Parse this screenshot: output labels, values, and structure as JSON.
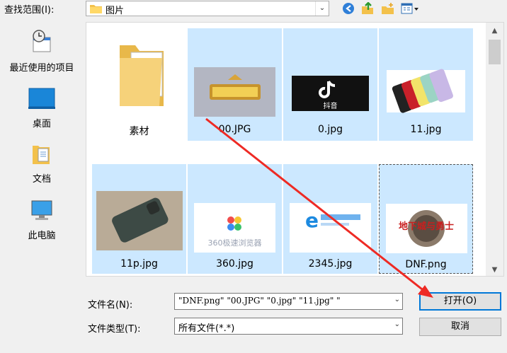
{
  "look_in": {
    "label": "查找范围(I):",
    "value": "图片"
  },
  "toolbar": {
    "icons": [
      "back-icon",
      "up-folder-icon",
      "new-folder-icon",
      "view-menu-icon"
    ]
  },
  "places": [
    {
      "label": "最近使用的项目",
      "icon": "recent-items-icon"
    },
    {
      "label": "桌面",
      "icon": "desktop-icon"
    },
    {
      "label": "文档",
      "icon": "documents-icon"
    },
    {
      "label": "此电脑",
      "icon": "this-pc-icon"
    }
  ],
  "files": [
    {
      "name": "素材",
      "type": "folder",
      "selected": false
    },
    {
      "name": "00.JPG",
      "type": "image",
      "selected": true
    },
    {
      "name": "0.jpg",
      "type": "image",
      "selected": true,
      "thumb_text": "抖音"
    },
    {
      "name": "11.jpg",
      "type": "image",
      "selected": true
    },
    {
      "name": "11p.jpg",
      "type": "image",
      "selected": true
    },
    {
      "name": "360.jpg",
      "type": "image",
      "selected": true,
      "thumb_text": "360极速浏览器"
    },
    {
      "name": "2345.jpg",
      "type": "image",
      "selected": true
    },
    {
      "name": "DNF.png",
      "type": "image",
      "selected": true,
      "focused": true,
      "thumb_text": "地下城与勇士"
    }
  ],
  "filename": {
    "label": "文件名(N):",
    "value": "\"DNF.png\" \"00.JPG\" \"0.jpg\" \"11.jpg\" \""
  },
  "filetype": {
    "label": "文件类型(T):",
    "value": "所有文件(*.*)"
  },
  "buttons": {
    "open": "打开(O)",
    "cancel": "取消"
  },
  "colors": {
    "selection": "#cce8ff",
    "focus_accent": "#0078d7",
    "arrow": "#ee2a24"
  }
}
